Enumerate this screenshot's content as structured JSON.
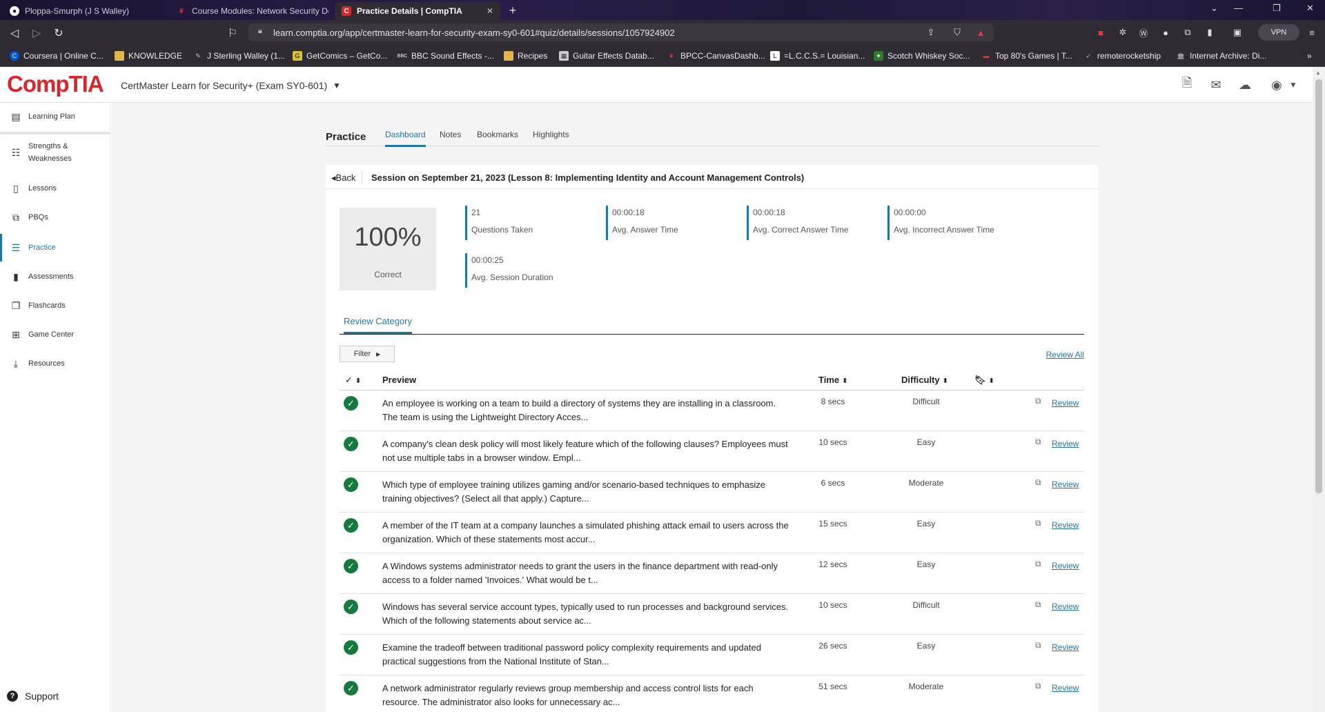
{
  "browser": {
    "tabs": [
      {
        "title": "Ploppa-Smurph (J S Walley)",
        "icon": "github-icon"
      },
      {
        "title": "Course Modules: Network Security De",
        "icon": "bpcc-icon"
      },
      {
        "title": "Practice Details | CompTIA",
        "icon": "comptia-icon",
        "active": true
      }
    ],
    "url": "learn.comptia.org/app/certmaster-learn-for-security-exam-sy0-601#quiz/details/sessions/1057924902",
    "vpn_label": "VPN",
    "bookmarks": [
      "Coursera | Online C...",
      "KNOWLEDGE",
      "J Sterling Walley (1...",
      "GetComics – GetCo...",
      "BBC Sound Effects -...",
      "Recipes",
      "Guitar Effects Datab...",
      "BPCC-CanvasDashb...",
      "=L.C.C.S.= Louisian...",
      "Scotch Whiskey Soc...",
      "Top 80's Games | T...",
      "remoterocketship",
      "Internet Archive: Di..."
    ]
  },
  "app": {
    "logo": "CompTIA",
    "course": "CertMaster Learn for Security+ (Exam SY0-601)"
  },
  "sidebar": {
    "items": [
      {
        "label": "Learning Plan",
        "icon": "learning-plan-icon"
      },
      {
        "label": "Strengths & Weaknesses",
        "icon": "strengths-icon"
      },
      {
        "label": "Lessons",
        "icon": "book-icon"
      },
      {
        "label": "PBQs",
        "icon": "pbq-icon"
      },
      {
        "label": "Practice",
        "icon": "practice-icon",
        "active": true
      },
      {
        "label": "Assessments",
        "icon": "clipboard-icon"
      },
      {
        "label": "Flashcards",
        "icon": "flashcards-icon"
      },
      {
        "label": "Game Center",
        "icon": "game-icon"
      },
      {
        "label": "Resources",
        "icon": "download-icon"
      }
    ],
    "support": "Support"
  },
  "practice": {
    "title": "Practice",
    "tabs": [
      "Dashboard",
      "Notes",
      "Bookmarks",
      "Highlights"
    ],
    "active_tab": "Dashboard",
    "back": "Back",
    "session_title": "Session on September 21, 2023 (Lesson 8: Implementing Identity and Account Management Controls)",
    "score": {
      "value": "100%",
      "label": "Correct"
    },
    "stats": [
      {
        "value": "21",
        "label": "Questions Taken"
      },
      {
        "value": "00:00:18",
        "label": "Avg. Answer Time"
      },
      {
        "value": "00:00:18",
        "label": "Avg. Correct Answer Time"
      },
      {
        "value": "00:00:00",
        "label": "Avg. Incorrect Answer Time"
      },
      {
        "value": "00:00:25",
        "label": "Avg. Session Duration"
      }
    ],
    "review_tab": "Review Category",
    "filter": "Filter",
    "review_all": "Review All",
    "columns": {
      "check": "✓",
      "preview": "Preview",
      "time": "Time",
      "difficulty": "Difficulty"
    },
    "review_label": "Review",
    "rows": [
      {
        "preview": "An employee is working on a team to build a directory of systems they are installing in a classroom. The team is using the Lightweight Directory Acces...",
        "time": "8 secs",
        "difficulty": "Difficult"
      },
      {
        "preview": "A company's clean desk policy will most likely feature which of the following clauses? Employees must not use multiple tabs in a browser window. Empl...",
        "time": "10 secs",
        "difficulty": "Easy"
      },
      {
        "preview": "Which type of employee training utilizes gaming and/or scenario-based techniques to emphasize training objectives? (Select all that apply.) Capture...",
        "time": "6 secs",
        "difficulty": "Moderate"
      },
      {
        "preview": "A member of the IT team at a company launches a simulated phishing attack email to users across the organization. Which of these statements most accur...",
        "time": "15 secs",
        "difficulty": "Easy"
      },
      {
        "preview": "A Windows systems administrator needs to grant the users in the finance department with read-only access to a folder named 'Invoices.' What would be t...",
        "time": "12 secs",
        "difficulty": "Easy"
      },
      {
        "preview": "Windows has several service account types, typically used to run processes and background services. Which of the following statements about service ac...",
        "time": "10 secs",
        "difficulty": "Difficult"
      },
      {
        "preview": "Examine the tradeoff between traditional password policy complexity requirements and updated practical suggestions from the National Institute of Stan...",
        "time": "26 secs",
        "difficulty": "Easy"
      },
      {
        "preview": "A network administrator regularly reviews group membership and access control lists for each resource. The administrator also looks for unnecessary ac...",
        "time": "51 secs",
        "difficulty": "Moderate"
      }
    ]
  },
  "colors": {
    "accent": "#1f77a8",
    "brand": "#d9262d",
    "correct": "#167a3e"
  }
}
